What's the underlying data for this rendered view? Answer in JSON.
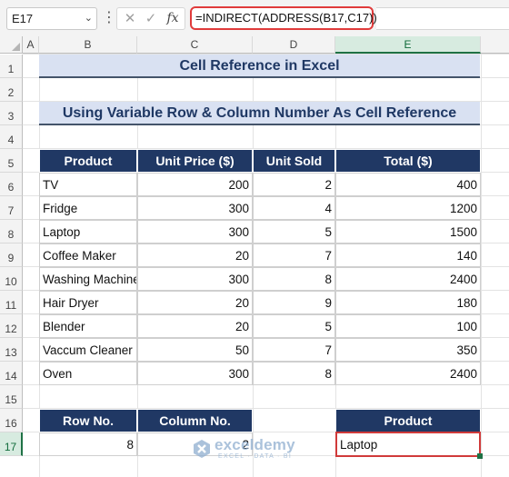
{
  "formula_bar": {
    "name_box": "E17",
    "fx_label": "fx",
    "formula": "=INDIRECT(ADDRESS(B17,C17))"
  },
  "columns": [
    "A",
    "B",
    "C",
    "D",
    "E"
  ],
  "rows": [
    "1",
    "2",
    "3",
    "4",
    "5",
    "6",
    "7",
    "8",
    "9",
    "10",
    "11",
    "12",
    "13",
    "14",
    "15",
    "16",
    "17"
  ],
  "title": "Cell Reference in Excel",
  "subtitle": "Using Variable Row & Column Number As Cell Reference",
  "table": {
    "headers": [
      "Product",
      "Unit Price ($)",
      "Unit Sold",
      "Total ($)"
    ],
    "rows": [
      [
        "TV",
        "200",
        "2",
        "400"
      ],
      [
        "Fridge",
        "300",
        "4",
        "1200"
      ],
      [
        "Laptop",
        "300",
        "5",
        "1500"
      ],
      [
        "Coffee Maker",
        "20",
        "7",
        "140"
      ],
      [
        "Washing Machine",
        "300",
        "8",
        "2400"
      ],
      [
        "Hair Dryer",
        "20",
        "9",
        "180"
      ],
      [
        "Blender",
        "20",
        "5",
        "100"
      ],
      [
        "Vaccum Cleaner",
        "50",
        "7",
        "350"
      ],
      [
        "Oven",
        "300",
        "8",
        "2400"
      ]
    ]
  },
  "lookup": {
    "row_header": "Row No.",
    "col_header": "Column No.",
    "row_value": "8",
    "col_value": "2",
    "result_header": "Product",
    "result_value": "Laptop"
  },
  "watermark": {
    "brand": "exceldemy",
    "tagline": "EXCEL · DATA · BI"
  },
  "colors": {
    "header_fill": "#203864",
    "title_fill": "#d9e1f2",
    "highlight_border": "#e03b3b",
    "selection": "#1e7145"
  }
}
